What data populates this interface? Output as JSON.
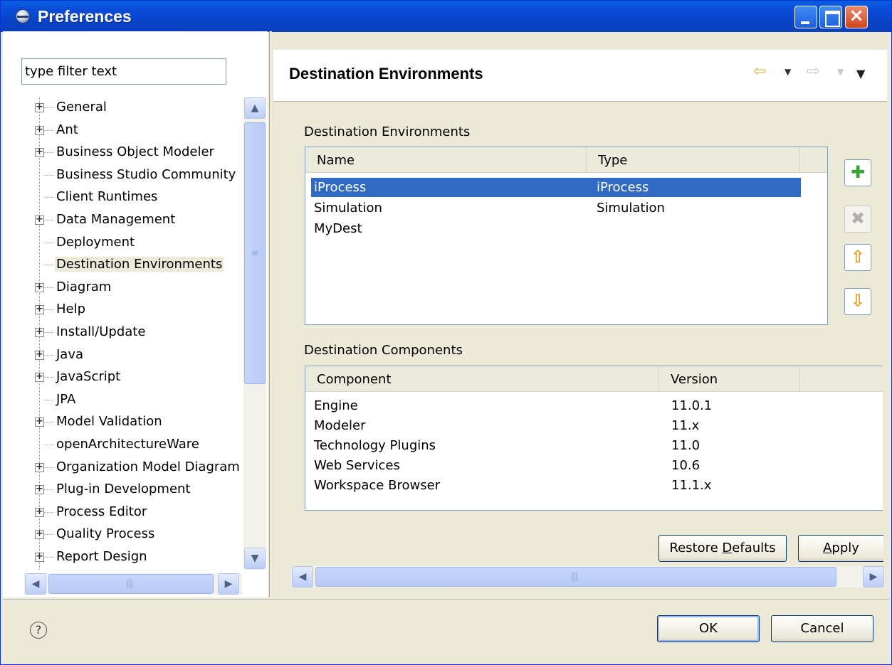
{
  "window": {
    "title": "Preferences",
    "title_icon": "eclipse-icon"
  },
  "filter": {
    "value": "type filter text"
  },
  "tree": {
    "items": [
      {
        "label": "General",
        "expandable": true
      },
      {
        "label": "Ant",
        "expandable": true
      },
      {
        "label": "Business Object Modeler",
        "expandable": true
      },
      {
        "label": "Business Studio Community",
        "expandable": false
      },
      {
        "label": "Client Runtimes",
        "expandable": false
      },
      {
        "label": "Data Management",
        "expandable": true
      },
      {
        "label": "Deployment",
        "expandable": false
      },
      {
        "label": "Destination Environments",
        "expandable": false,
        "selected": true
      },
      {
        "label": "Diagram",
        "expandable": true
      },
      {
        "label": "Help",
        "expandable": true
      },
      {
        "label": "Install/Update",
        "expandable": true
      },
      {
        "label": "Java",
        "expandable": true
      },
      {
        "label": "JavaScript",
        "expandable": true
      },
      {
        "label": "JPA",
        "expandable": false
      },
      {
        "label": "Model Validation",
        "expandable": true
      },
      {
        "label": "openArchitectureWare",
        "expandable": false
      },
      {
        "label": "Organization Model Diagram",
        "expandable": true
      },
      {
        "label": "Plug-in Development",
        "expandable": true
      },
      {
        "label": "Process Editor",
        "expandable": true
      },
      {
        "label": "Quality Process",
        "expandable": true
      },
      {
        "label": "Report Design",
        "expandable": true
      }
    ]
  },
  "page": {
    "title": "Destination Environments",
    "environments_label": "Destination Environments",
    "env_columns": [
      "Name",
      "Type"
    ],
    "env_rows": [
      {
        "name": "iProcess",
        "type": "iProcess",
        "selected": true
      },
      {
        "name": "Simulation",
        "type": "Simulation"
      },
      {
        "name": "MyDest",
        "type": ""
      }
    ],
    "components_label": "Destination Components",
    "comp_columns": [
      "Component",
      "Version"
    ],
    "comp_rows": [
      {
        "component": "Engine",
        "version": "11.0.1"
      },
      {
        "component": "Modeler",
        "version": "11.x"
      },
      {
        "component": "Technology Plugins",
        "version": "11.0"
      },
      {
        "component": "Web Services",
        "version": "10.6"
      },
      {
        "component": "Workspace Browser",
        "version": "11.1.x"
      }
    ],
    "restore_defaults_label": "Restore Defaults",
    "restore_defaults_mnemonic": "D",
    "apply_label": "Apply",
    "apply_mnemonic": "A"
  },
  "footer": {
    "ok_label": "OK",
    "cancel_label": "Cancel"
  },
  "colors": {
    "selection": "#316ac5",
    "titlebar": "#0a4cd8",
    "dialog_bg": "#ece9d8",
    "add_green": "#3aa63a",
    "arrow_orange": "#e8a020"
  }
}
